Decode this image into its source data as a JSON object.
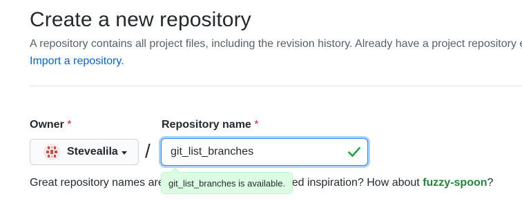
{
  "header": {
    "title": "Create a new repository",
    "description": "A repository contains all project files, including the revision history. Already have a project repository elsewhere?",
    "import_link": "Import a repository."
  },
  "form": {
    "owner": {
      "label": "Owner",
      "required_mark": "*",
      "selected": "Stevealila",
      "avatar_icon": "identicon-avatar",
      "dropdown_icon": "caret-down-icon"
    },
    "separator": "/",
    "repo_name": {
      "label": "Repository name",
      "required_mark": "*",
      "value": "git_list_branches",
      "status_icon": "checkmark-icon",
      "status_color": "#28a745"
    },
    "availability_tooltip": "git_list_branches is available.",
    "hint": {
      "text": "Great repository names are short and memorable. Need inspiration? How about ",
      "suggestion": "fuzzy-spoon",
      "suffix": "?"
    }
  }
}
